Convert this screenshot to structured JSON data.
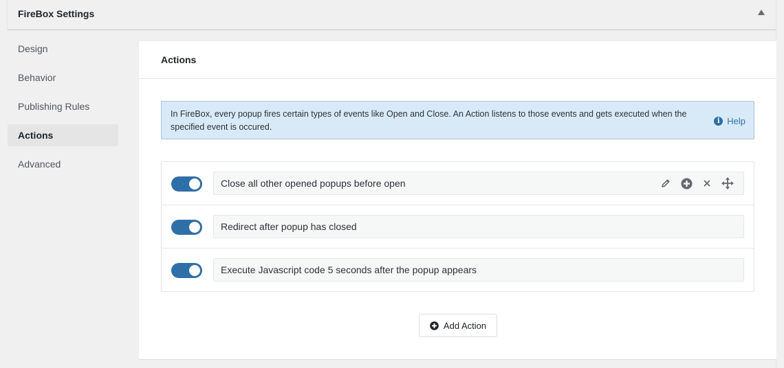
{
  "header": {
    "title": "FireBox Settings",
    "collapse_icon": "triangle-up-icon"
  },
  "sidebar": {
    "items": [
      {
        "label": "Design",
        "active": false
      },
      {
        "label": "Behavior",
        "active": false
      },
      {
        "label": "Publishing Rules",
        "active": false
      },
      {
        "label": "Actions",
        "active": true
      },
      {
        "label": "Advanced",
        "active": false
      }
    ]
  },
  "panel": {
    "title": "Actions",
    "notice": {
      "text": "In FireBox, every popup fires certain types of events like Open and Close. An Action listens to those events and gets executed when the specified event is occured.",
      "help_label": "Help",
      "help_icon": "info-circle-icon"
    },
    "actions": [
      {
        "label": "Close all other opened popups before open",
        "enabled": true
      },
      {
        "label": "Redirect after popup has closed",
        "enabled": true
      },
      {
        "label": "Execute Javascript code 5 seconds after the popup appears",
        "enabled": true
      }
    ],
    "row_tools": [
      "pencil-icon",
      "plus-circle-icon",
      "close-icon",
      "move-icon"
    ],
    "add_action_label": "Add Action"
  },
  "colors": {
    "accent": "#2f6fa7",
    "notice_bg": "#d8eaf8",
    "page_bg": "#f0f0f0"
  }
}
